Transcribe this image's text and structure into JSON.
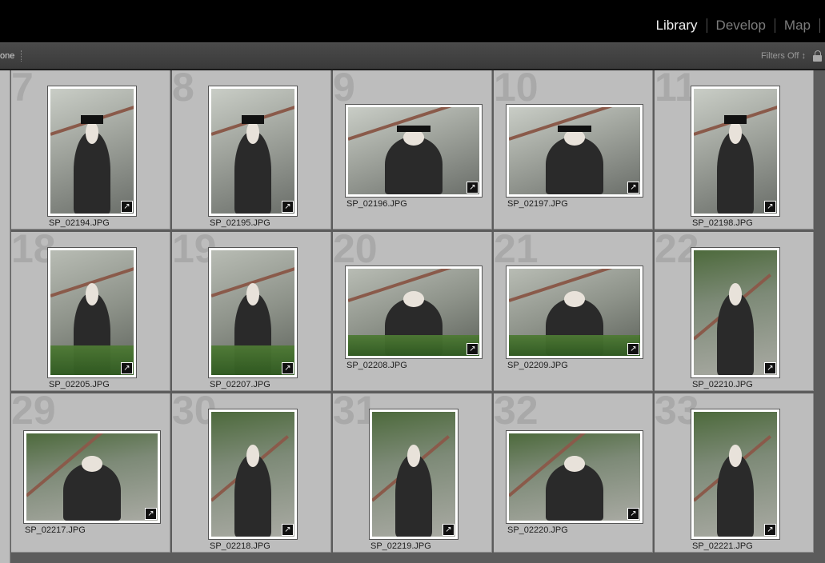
{
  "modules": [
    {
      "label": "Library",
      "active": true
    },
    {
      "label": "Develop",
      "active": false
    },
    {
      "label": "Map",
      "active": false
    }
  ],
  "filterbar": {
    "left_label": "one",
    "filters_label": "Filters Off ↕",
    "lock_icon": "lock-icon"
  },
  "rows": [
    [
      {
        "num": "7",
        "file": "SP_02194.JPG",
        "orient": "portrait",
        "scene": "building"
      },
      {
        "num": "8",
        "file": "SP_02195.JPG",
        "orient": "portrait",
        "scene": "building"
      },
      {
        "num": "9",
        "file": "SP_02196.JPG",
        "orient": "landscape",
        "scene": "building"
      },
      {
        "num": "10",
        "file": "SP_02197.JPG",
        "orient": "landscape",
        "scene": "building"
      },
      {
        "num": "11",
        "file": "SP_02198.JPG",
        "orient": "portrait",
        "scene": "building"
      }
    ],
    [
      {
        "num": "18",
        "file": "SP_02205.JPG",
        "orient": "portrait",
        "scene": "plants"
      },
      {
        "num": "19",
        "file": "SP_02207.JPG",
        "orient": "portrait",
        "scene": "plants"
      },
      {
        "num": "20",
        "file": "SP_02208.JPG",
        "orient": "landscape",
        "scene": "plants"
      },
      {
        "num": "21",
        "file": "SP_02209.JPG",
        "orient": "landscape",
        "scene": "plants"
      },
      {
        "num": "22",
        "file": "SP_02210.JPG",
        "orient": "portrait",
        "scene": "stairs"
      }
    ],
    [
      {
        "num": "29",
        "file": "SP_02217.JPG",
        "orient": "landscape",
        "scene": "stairs"
      },
      {
        "num": "30",
        "file": "SP_02218.JPG",
        "orient": "portrait",
        "scene": "stairs"
      },
      {
        "num": "31",
        "file": "SP_02219.JPG",
        "orient": "portrait",
        "scene": "stairs"
      },
      {
        "num": "32",
        "file": "SP_02220.JPG",
        "orient": "landscape",
        "scene": "stairs"
      },
      {
        "num": "33",
        "file": "SP_02221.JPG",
        "orient": "portrait",
        "scene": "stairs"
      }
    ]
  ],
  "badge_icon": "develop-adjusted-icon",
  "badge_glyph": "↗",
  "colors": {
    "cell_bg": "#bdbdbd",
    "active_module": "#f0f0f0",
    "inactive_module": "#7c7c7c"
  }
}
